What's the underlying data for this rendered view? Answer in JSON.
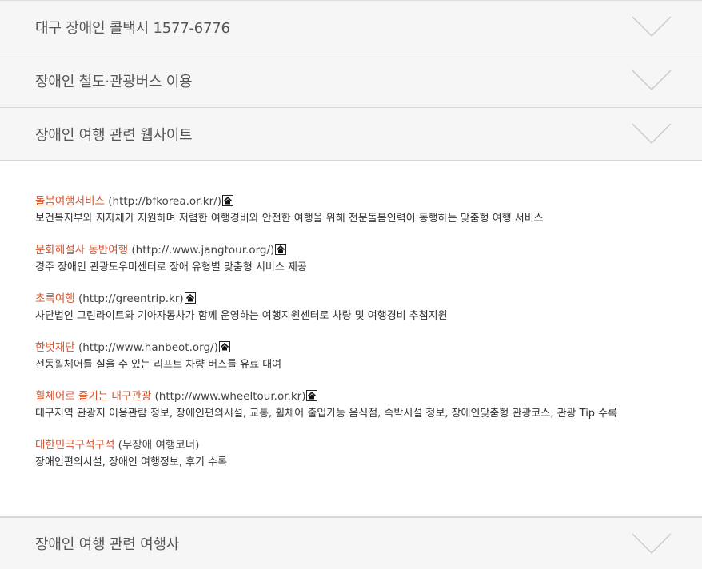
{
  "accordion": {
    "sections": [
      {
        "label": "대구 장애인 콜택시 1577-6776"
      },
      {
        "label": "장애인 철도·관광버스 이용"
      },
      {
        "label": "장애인 여행 관련 웹사이트"
      },
      {
        "label": "장애인 여행 관련 여행사"
      }
    ]
  },
  "websites": [
    {
      "name": "돌봄여행서비스",
      "url": "(http://bfkorea.or.kr/)",
      "has_icon": true,
      "desc": "보건복지부와 지자체가 지원하며 저렴한 여행경비와 안전한 여행을 위해 전문돌봄인력이 동행하는 맞춤형 여행 서비스"
    },
    {
      "name": "문화해설사 동반여행",
      "url": "(http://.www.jangtour.org/)",
      "has_icon": true,
      "desc": "경주 장애인 관광도우미센터로 장애 유형별 맞춤형 서비스 제공"
    },
    {
      "name": "초록여행",
      "url": "(http://greentrip.kr)",
      "has_icon": true,
      "desc": "사단법인 그린라이트와 기아자동차가 함께 운영하는 여행지원센터로 차량 및 여행경비 추첨지원"
    },
    {
      "name": "한벗재단",
      "url": "(http://www.hanbeot.org/)",
      "has_icon": true,
      "desc": "전동휠체어를 실을 수 있는 리프트 차량 버스를 유료 대여"
    },
    {
      "name": "휠체어로 즐기는 대구관광",
      "url": "(http://www.wheeltour.or.kr)",
      "has_icon": true,
      "desc": "대구지역 관광지 이용관람 정보, 장애인편의시설, 교통, 휠체어 출입가능 음식점, 숙박시설 정보, 장애인맞춤형 관광코스, 관광 Tip 수록"
    },
    {
      "name": "대한민국구석구석",
      "url": "(무장애 여행코너)",
      "has_icon": false,
      "desc": "장애인편의시설, 장애인 여행정보, 후기 수록"
    }
  ],
  "icons": {
    "chevron": "chevron-down-icon",
    "link": "home-link-icon"
  },
  "colors": {
    "accent": "#d4552f",
    "header_bg": "#f6f6f6",
    "chevron": "#cfcfcf"
  }
}
